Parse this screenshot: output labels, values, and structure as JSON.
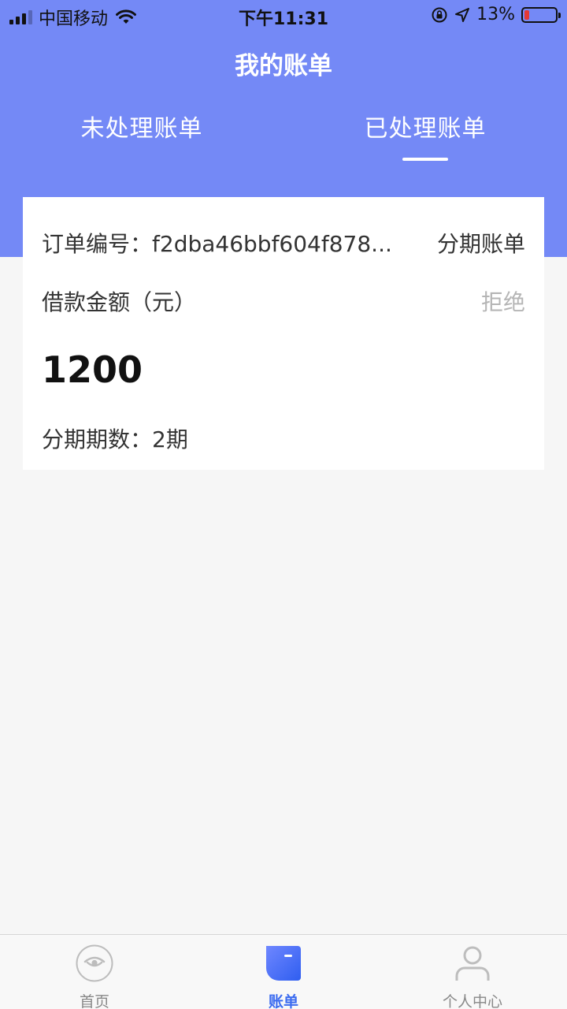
{
  "status_bar": {
    "carrier": "中国移动",
    "time": "下午11:31",
    "battery": "13%",
    "battery_level": 0.13
  },
  "header": {
    "title": "我的账单"
  },
  "tabs": [
    {
      "label": "未处理账单",
      "active": false
    },
    {
      "label": "已处理账单",
      "active": true
    }
  ],
  "bill": {
    "order_label": "订单编号：",
    "order_no": "f2dba46bbf604f878...",
    "bill_type": "分期账单",
    "amount_label": "借款金额（元）",
    "status": "拒绝",
    "amount": "1200",
    "installments_label": "分期期数：",
    "installments_value": "2期"
  },
  "tabbar": [
    {
      "label": "首页",
      "icon": "home-eye-icon"
    },
    {
      "label": "账单",
      "icon": "bill-icon",
      "active": true
    },
    {
      "label": "个人中心",
      "icon": "person-icon"
    }
  ],
  "colors": {
    "header": "#7489f6",
    "accent": "#3c6cf0",
    "status_reject": "#b5b5b5"
  }
}
